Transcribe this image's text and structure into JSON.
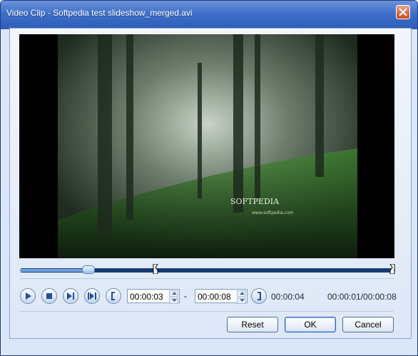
{
  "window": {
    "title": "Video Clip - Softpedia test slideshow_merged.avi"
  },
  "video": {
    "overlay_text": "SOFTPEDIA",
    "overlay_url": "www.softpedia.com"
  },
  "seek": {
    "progress_fraction": 0.18
  },
  "controls": {
    "buttons": [
      "play-icon",
      "stop-icon",
      "next-frame-icon",
      "skip-to-end-icon",
      "mark-in-icon",
      "mark-out-icon"
    ]
  },
  "timing": {
    "start": "00:00:03",
    "separator": "-",
    "end": "00:00:08",
    "duration": "00:00:04",
    "position": "00:00:01/00:00:08"
  },
  "actions": {
    "reset": "Reset",
    "ok": "OK",
    "cancel": "Cancel"
  },
  "colors": {
    "titlebar": "#3e6fc8",
    "seekbar": "#163a74",
    "close": "#c8461d"
  }
}
